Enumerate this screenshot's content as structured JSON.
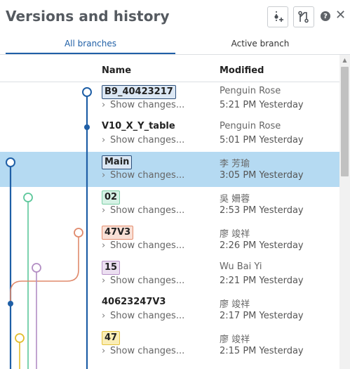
{
  "header": {
    "title": "Versions and history",
    "buttons": [
      {
        "name": "create-version-button",
        "icon": "add-version-icon"
      },
      {
        "name": "compare-button",
        "icon": "compare-branches-icon"
      }
    ],
    "help_label": "?",
    "close_label": "✕"
  },
  "tabs": [
    {
      "label": "All branches",
      "active": true
    },
    {
      "label": "Active branch",
      "active": false
    }
  ],
  "columns": {
    "name": "Name",
    "modified": "Modified"
  },
  "show_changes_label": "Show changes...",
  "rows": [
    {
      "name": "B9_40423217",
      "tag": "blue",
      "author": "Penguin Rose",
      "time": "5:21 PM Yesterday",
      "selected": false
    },
    {
      "name": "V10_X_Y_table",
      "tag": "none",
      "author": "Penguin Rose",
      "time": "5:01 PM Yesterday",
      "selected": false
    },
    {
      "name": "Main",
      "tag": "blue",
      "author": "李 芳瑜",
      "time": "3:05 PM Yesterday",
      "selected": true
    },
    {
      "name": "02",
      "tag": "green",
      "author": "吳 姍蓉",
      "time": "2:53 PM Yesterday",
      "selected": false
    },
    {
      "name": "47V3",
      "tag": "orange",
      "author": "廖 竣祥",
      "time": "2:26 PM Yesterday",
      "selected": false
    },
    {
      "name": "15",
      "tag": "purple",
      "author": "Wu Bai Yi",
      "time": "2:21 PM Yesterday",
      "selected": false
    },
    {
      "name": "40623247V3",
      "tag": "none",
      "author": "廖 竣祥",
      "time": "2:17 PM Yesterday",
      "selected": false
    },
    {
      "name": "47",
      "tag": "yellow",
      "author": "廖 竣祥",
      "time": "2:15 PM Yesterday",
      "selected": false
    }
  ],
  "colors": {
    "accent": "#1f5fa6",
    "selected_row": "#b5daf2",
    "branch_blue": "#1f5fa6",
    "branch_green": "#5cc79a",
    "branch_orange": "#e08a6c",
    "branch_purple": "#b38ec4",
    "branch_yellow": "#e2bd2c"
  }
}
